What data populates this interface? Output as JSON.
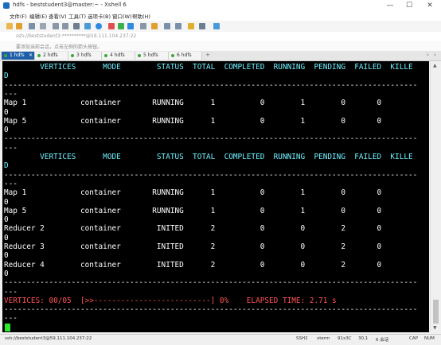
{
  "window": {
    "title": "hdfs - beststudent3@master:~ - Xshell 6",
    "minimize": "—",
    "maximize": "☐",
    "close": "✕"
  },
  "menu": [
    "文件(F)",
    "编辑(E)",
    "查看(V)",
    "工具(T)",
    "选项卡(B)",
    "窗口(W)",
    "帮助(H)"
  ],
  "address": {
    "value": "ssh://beststudent3:**********@59.111.104.237:22"
  },
  "hint": {
    "text": "要添加当前会话，点击左侧的箭头按钮。"
  },
  "tabs": [
    {
      "label": "1 hdfs",
      "active": true
    },
    {
      "label": "2 hdfs",
      "active": false
    },
    {
      "label": "3 hdfs",
      "active": false
    },
    {
      "label": "4 hdfs",
      "active": false
    },
    {
      "label": "5 hdfs",
      "active": false
    },
    {
      "label": "6 hdfs",
      "active": false
    }
  ],
  "terminal": {
    "lines": [
      {
        "text": "        VERTICES      MODE        STATUS  TOTAL  COMPLETED  RUNNING  PENDING  FAILED  KILLE",
        "style": "hdr"
      },
      {
        "text": "D",
        "style": "hdr"
      },
      {
        "text": "--------------------------------------------------------------------------------------------",
        "style": ""
      },
      {
        "text": "---",
        "style": ""
      },
      {
        "text": "Map 1            container       RUNNING      1          0        1        0       0",
        "style": ""
      },
      {
        "text": "0",
        "style": ""
      },
      {
        "text": "Map 5            container       RUNNING      1          0        1        0       0",
        "style": ""
      },
      {
        "text": "0",
        "style": ""
      },
      {
        "text": "--------------------------------------------------------------------------------------------",
        "style": ""
      },
      {
        "text": "---",
        "style": ""
      },
      {
        "text": "        VERTICES      MODE        STATUS  TOTAL  COMPLETED  RUNNING  PENDING  FAILED  KILLE",
        "style": "hdr"
      },
      {
        "text": "D",
        "style": "hdr"
      },
      {
        "text": "--------------------------------------------------------------------------------------------",
        "style": ""
      },
      {
        "text": "---",
        "style": ""
      },
      {
        "text": "Map 1            container       RUNNING      1          0        1        0       0",
        "style": ""
      },
      {
        "text": "0",
        "style": ""
      },
      {
        "text": "Map 5            container       RUNNING      1          0        1        0       0",
        "style": ""
      },
      {
        "text": "0",
        "style": ""
      },
      {
        "text": "Reducer 2        container        INITED      2          0        0        2       0",
        "style": ""
      },
      {
        "text": "0",
        "style": ""
      },
      {
        "text": "Reducer 3        container        INITED      2          0        0        2       0",
        "style": ""
      },
      {
        "text": "0",
        "style": ""
      },
      {
        "text": "Reducer 4        container        INITED      2          0        0        2       0",
        "style": ""
      },
      {
        "text": "0",
        "style": ""
      },
      {
        "text": "--------------------------------------------------------------------------------------------",
        "style": ""
      },
      {
        "text": "---",
        "style": ""
      },
      {
        "text": "VERTICES: 00/05  [>>--------------------------] 0%    ELAPSED TIME: 2.71 s",
        "style": "red"
      },
      {
        "text": "--------------------------------------------------------------------------------------------",
        "style": ""
      },
      {
        "text": "---",
        "style": ""
      }
    ]
  },
  "status": {
    "connection": "ssh://beststudent3@59.111.104.237:22",
    "protocol": "SSH2",
    "terminal_type": "xterm",
    "size": "91x3C",
    "position": "30,1",
    "sessions": "6 会话",
    "caps": "CAP",
    "num": "NUM"
  }
}
